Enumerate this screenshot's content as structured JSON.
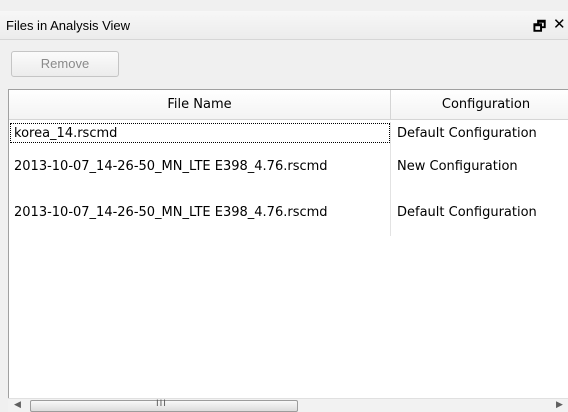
{
  "panel": {
    "title": "Files in Analysis View",
    "float_glyph": "🗗",
    "close_glyph": "✕"
  },
  "toolbar": {
    "remove_label": "Remove"
  },
  "table": {
    "columns": [
      "File Name",
      "Configuration"
    ],
    "rows": [
      {
        "file": "korea_14.rscmd",
        "config": "Default Configuration"
      },
      {
        "file": "2013-10-07_14-26-50_MN_LTE E398_4.76.rscmd",
        "config": "New Configuration"
      },
      {
        "file": "2013-10-07_14-26-50_MN_LTE E398_4.76.rscmd",
        "config": "Default Configuration"
      }
    ]
  },
  "scrollbar": {
    "left_arrow": "◀",
    "right_arrow": "▶",
    "grip": "III"
  },
  "icons": {
    "float": "restore-window-icon",
    "close": "close-icon"
  }
}
